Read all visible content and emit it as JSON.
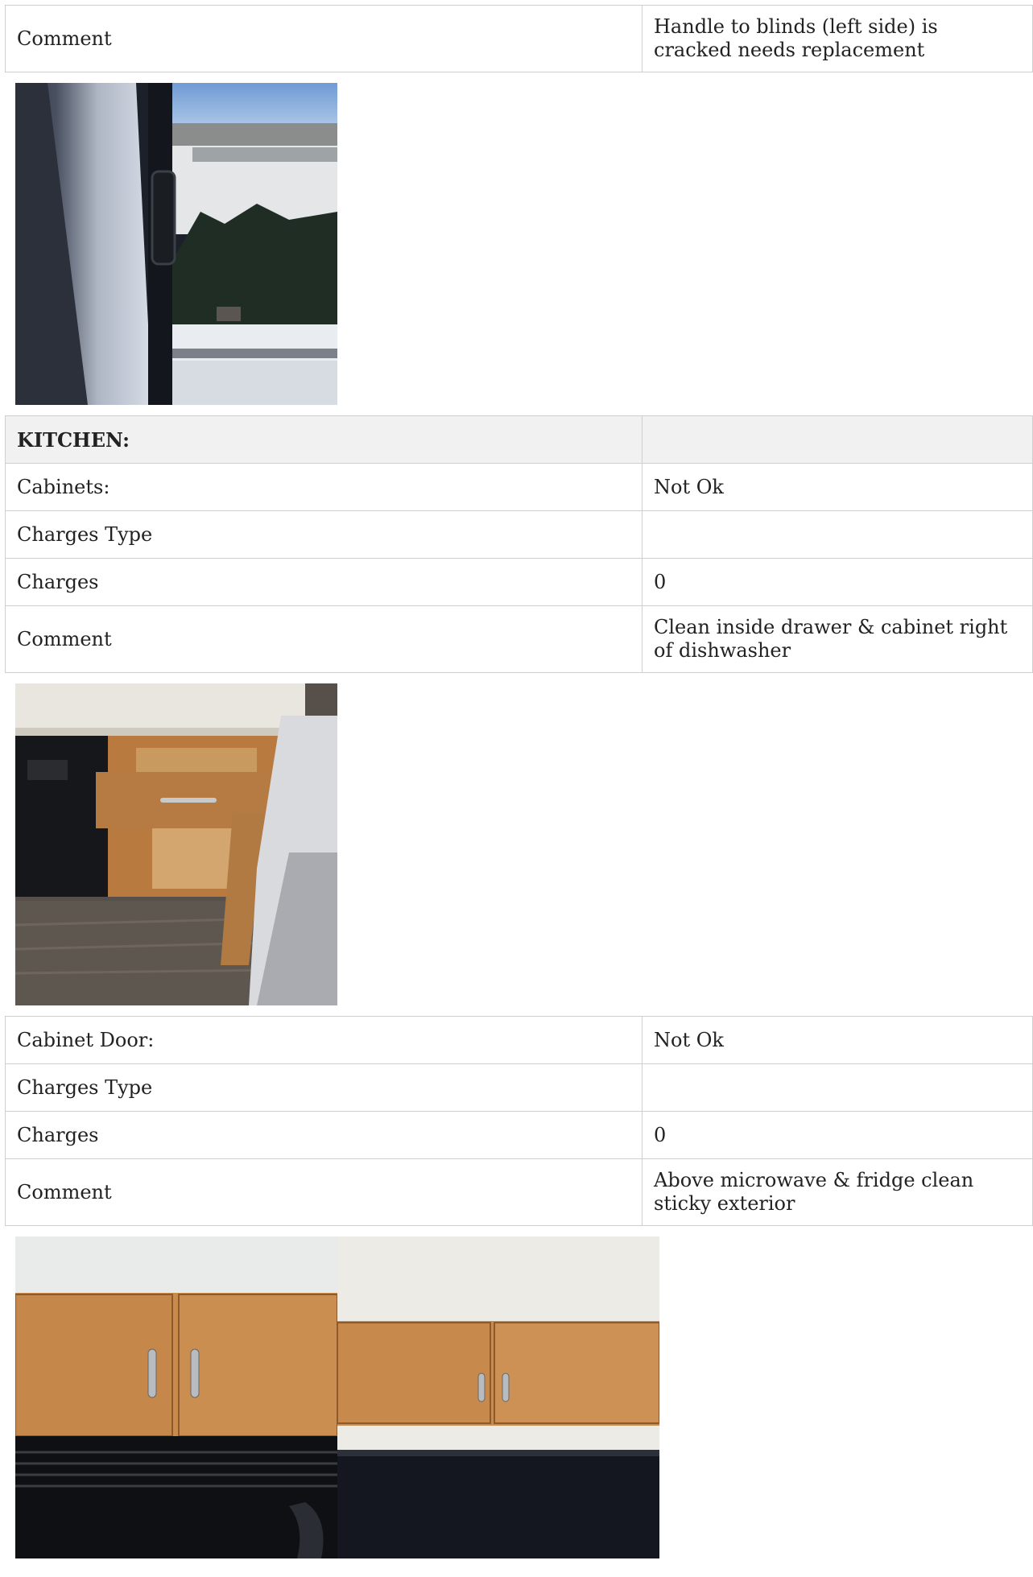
{
  "window_section": {
    "comment_label": "Comment",
    "comment_value": "Handle to blinds (left side) is cracked needs replacement"
  },
  "kitchen": {
    "section_title": "KITCHEN:",
    "cabinets": {
      "label": "Cabinets:",
      "value": "Not Ok",
      "charges_type_label": "Charges Type",
      "charges_type_value": "",
      "charges_label": "Charges",
      "charges_value": "0",
      "comment_label": "Comment",
      "comment_value": "Clean inside drawer & cabinet right of dishwasher"
    },
    "cabinet_door": {
      "label": "Cabinet Door:",
      "value": "Not Ok",
      "charges_type_label": "Charges Type",
      "charges_type_value": "",
      "charges_label": "Charges",
      "charges_value": "0",
      "comment_label": "Comment",
      "comment_value": "Above microwave & fridge clean sticky exterior"
    }
  },
  "colors": {
    "border": "#cfcfcf",
    "section_background": "#f1f1f1",
    "text": "#222222"
  }
}
